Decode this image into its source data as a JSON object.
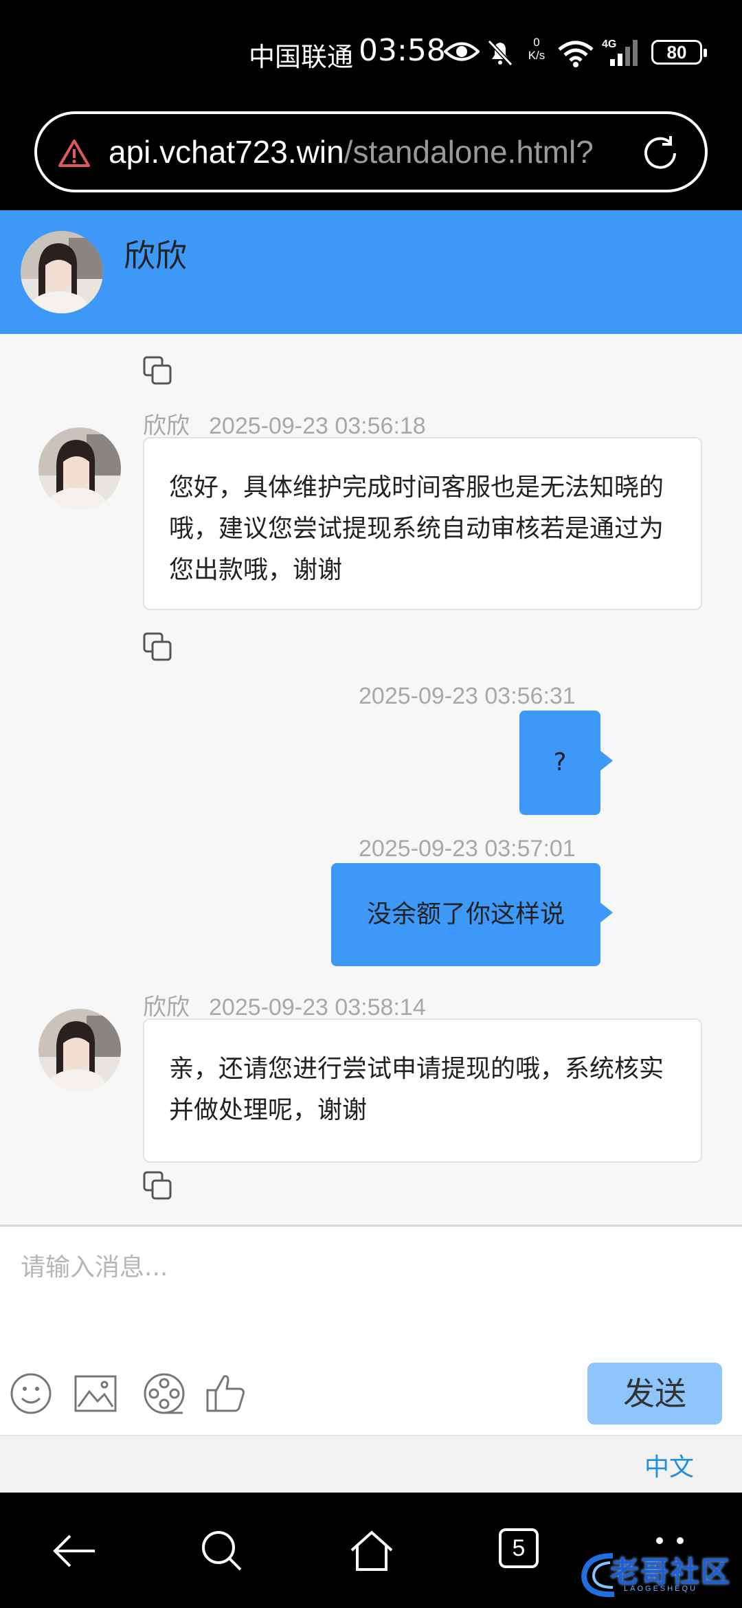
{
  "status_bar": {
    "carrier": "中国联通",
    "time": "03:58",
    "net_speed_value": "0",
    "net_speed_unit": "K/s",
    "network_type": "4G",
    "battery": "80"
  },
  "browser": {
    "url_host": "api.vchat723.win",
    "url_path": "/standalone.html?"
  },
  "chat": {
    "agent_name": "欣欣",
    "messages": [
      {
        "sender": "欣欣",
        "timestamp": "2025-09-23 03:56:18",
        "text": "您好，具体维护完成时间客服也是无法知晓的哦，建议您尝试提现系统自动审核若是通过为您出款哦，谢谢"
      },
      {
        "timestamp": "2025-09-23 03:56:31",
        "text": "?"
      },
      {
        "timestamp": "2025-09-23 03:57:01",
        "text": "没余额了你这样说"
      },
      {
        "sender": "欣欣",
        "timestamp": "2025-09-23 03:58:14",
        "text": "亲，还请您进行尝试申请提现的哦，系统核实并做处理呢，谢谢"
      }
    ]
  },
  "composer": {
    "placeholder": "请输入消息...",
    "send_label": "发送",
    "tools": [
      "emoji-icon",
      "image-icon",
      "video-icon",
      "thumbs-up-icon"
    ]
  },
  "language": {
    "label": "中文"
  },
  "nav": {
    "tabs_count": "5"
  },
  "watermark": {
    "text": "老哥社区",
    "subtext": "LAOGESHEQU"
  },
  "colors": {
    "header": "#3d98f7",
    "outgoing_bubble": "#3d98f7",
    "send_button": "#8ec5fb",
    "link": "#1f8fe0"
  }
}
